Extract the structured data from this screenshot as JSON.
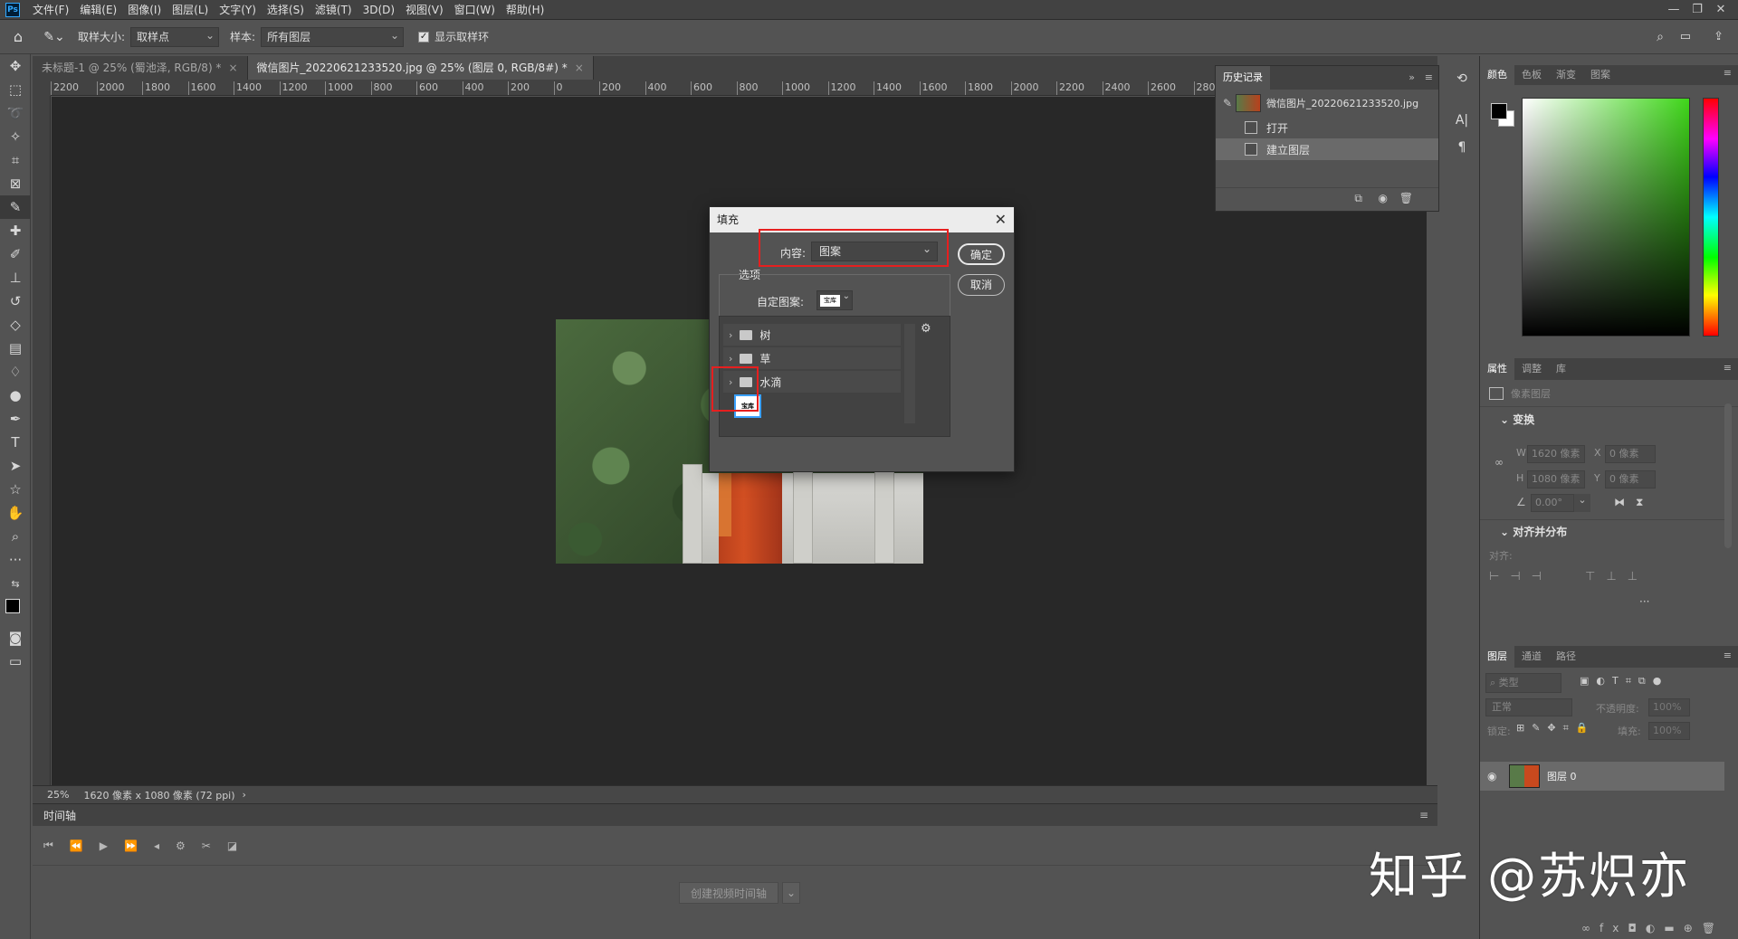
{
  "app": {
    "logo": "Ps",
    "menu": [
      "文件(F)",
      "编辑(E)",
      "图像(I)",
      "图层(L)",
      "文字(Y)",
      "选择(S)",
      "滤镜(T)",
      "3D(D)",
      "视图(V)",
      "窗口(W)",
      "帮助(H)"
    ],
    "window_buttons": [
      "—",
      "❐",
      "✕"
    ]
  },
  "options": {
    "sample_size_label": "取样大小:",
    "sample_size_value": "取样点",
    "sample_label": "样本:",
    "sample_value": "所有图层",
    "show_ring_label": "显示取样环",
    "show_ring_checked": true
  },
  "tabs": [
    {
      "label": "未标题-1 @ 25% (蜀池泽, RGB/8) *",
      "close": "×"
    },
    {
      "label": "微信图片_20220621233520.jpg @ 25% (图层 0, RGB/8#) *",
      "close": "×"
    }
  ],
  "ruler": {
    "h_ticks": [
      "2200",
      "2000",
      "1800",
      "1600",
      "1400",
      "1200",
      "1000",
      "800",
      "600",
      "400",
      "200",
      "0",
      "200",
      "400",
      "600",
      "800",
      "1000",
      "1200",
      "1400",
      "1600",
      "1800",
      "2000",
      "2200",
      "2400",
      "2600",
      "2800"
    ],
    "v_marks": [
      "1",
      "0",
      "8",
      "6",
      "4",
      "2",
      "0",
      "2",
      "4",
      "6",
      "8",
      "1",
      "2",
      "1",
      "4",
      "1",
      "6"
    ]
  },
  "status": {
    "zoom": "25%",
    "doc_size": "1620 像素 x 1080 像素 (72 ppi)",
    "arrow": "›"
  },
  "timeline": {
    "title": "时间轴",
    "create_button": "创建视频时间轴"
  },
  "history": {
    "title": "历史记录",
    "snapshot": "微信图片_20220621233520.jpg",
    "items": [
      {
        "label": "打开",
        "selected": false
      },
      {
        "label": "建立图层",
        "selected": true
      }
    ]
  },
  "color_panel": {
    "tabs": [
      "颜色",
      "色板",
      "渐变",
      "图案"
    ],
    "foreground": "#000000",
    "background": "#ffffff",
    "hue": "#3fd61a"
  },
  "properties": {
    "tabs": [
      "属性",
      "调整",
      "库"
    ],
    "layer_kind": "像素图层",
    "transform_title": "变换",
    "w_label": "W",
    "w_value": "1620 像素",
    "h_label": "H",
    "h_value": "1080 像素",
    "x_label": "X",
    "x_value": "0 像素",
    "y_label": "Y",
    "y_value": "0 像素",
    "angle_value": "0.00°",
    "align_title": "对齐并分布",
    "align_label": "对齐:",
    "more": "···"
  },
  "layers": {
    "tabs": [
      "图层",
      "通道",
      "路径"
    ],
    "search_placeholder": "类型",
    "blend_mode": "正常",
    "opacity_label": "不透明度:",
    "opacity_value": "100%",
    "lock_label": "锁定:",
    "fill_label": "填充:",
    "fill_value": "100%",
    "layer_name": "图层 0"
  },
  "dialog": {
    "title": "填充",
    "close": "✕",
    "content_label": "内容:",
    "content_value": "图案",
    "ok": "确定",
    "cancel": "取消",
    "options_label": "选项",
    "custom_pattern_label": "自定图案:",
    "pattern_name": "宝库",
    "folders": [
      "树",
      "草",
      "水滴"
    ],
    "gear": "⚙"
  },
  "watermark": "知乎 @苏炽亦",
  "highlight_color": "#e61f1f"
}
